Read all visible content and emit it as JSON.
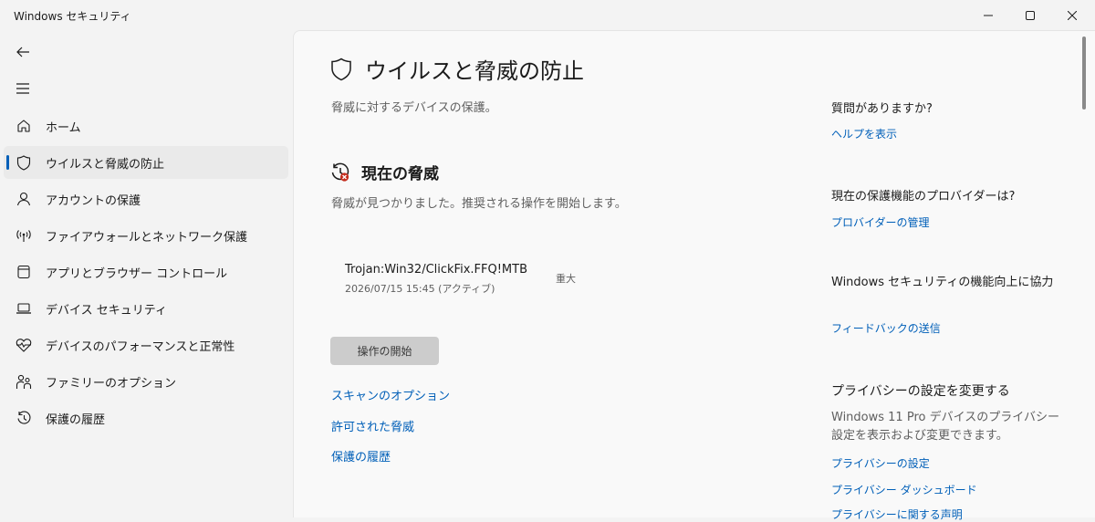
{
  "window": {
    "title": "Windows セキュリティ"
  },
  "sidebar": {
    "items": [
      {
        "label": "ホーム",
        "icon": "home-icon"
      },
      {
        "label": "ウイルスと脅威の防止",
        "icon": "shield-icon",
        "selected": true
      },
      {
        "label": "アカウントの保護",
        "icon": "person-icon"
      },
      {
        "label": "ファイアウォールとネットワーク保護",
        "icon": "wireless-icon"
      },
      {
        "label": "アプリとブラウザー コントロール",
        "icon": "browser-window-icon"
      },
      {
        "label": "デバイス セキュリティ",
        "icon": "laptop-icon"
      },
      {
        "label": "デバイスのパフォーマンスと正常性",
        "icon": "heart-pulse-icon"
      },
      {
        "label": "ファミリーのオプション",
        "icon": "family-icon"
      },
      {
        "label": "保護の履歴",
        "icon": "history-icon"
      }
    ]
  },
  "main": {
    "title": "ウイルスと脅威の防止",
    "subtitle": "脅威に対するデバイスの保護。",
    "current_threats": {
      "title": "現在の脅威",
      "description": "脅威が見つかりました。推奨される操作を開始します。",
      "threat": {
        "name": "Trojan:Win32/ClickFix.FFQ!MTB",
        "date": "2026/07/15 15:45 (アクティブ)",
        "severity": "重大"
      },
      "action_button": "操作の開始"
    },
    "links": {
      "scan_options": "スキャンのオプション",
      "allowed_threats": "許可された脅威",
      "protection_history": "保護の履歴"
    }
  },
  "right_panel": {
    "question": {
      "heading": "質問がありますか?",
      "link": "ヘルプを表示"
    },
    "provider": {
      "heading": "現在の保護機能のプロバイダーは?",
      "link": "プロバイダーの管理"
    },
    "improve": {
      "heading": "Windows セキュリティの機能向上に協力",
      "link": "フィードバックの送信"
    },
    "privacy": {
      "heading": "プライバシーの設定を変更する",
      "text": "Windows 11 Pro デバイスのプライバシー設定を表示および変更できます。",
      "links": [
        "プライバシーの設定",
        "プライバシー ダッシュボード",
        "プライバシーに関する声明"
      ]
    }
  },
  "colors": {
    "accent": "#005fb8",
    "threat_badge": "#c42b1c"
  }
}
